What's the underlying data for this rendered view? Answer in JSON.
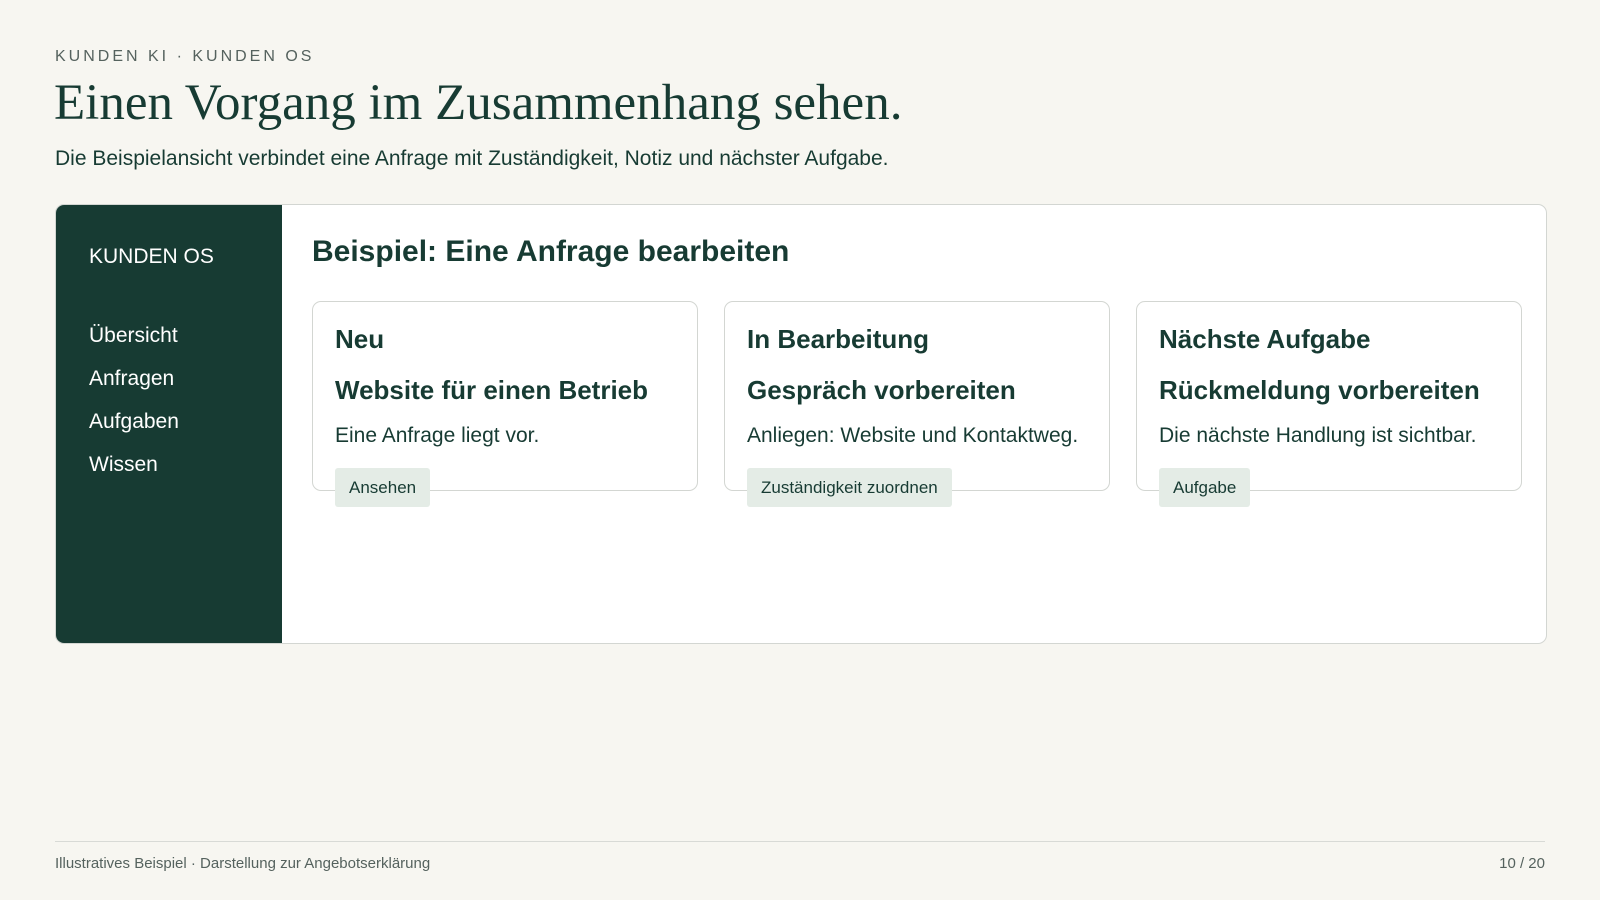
{
  "header": {
    "eyebrow": "KUNDEN KI · KUNDEN OS",
    "title": "Einen Vorgang im Zusammenhang sehen.",
    "subtitle": "Die Beispielansicht verbindet eine Anfrage mit Zuständigkeit, Notiz und nächster Aufgabe."
  },
  "app": {
    "brand": "KUNDEN OS",
    "nav": [
      {
        "label": "Übersicht"
      },
      {
        "label": "Anfragen"
      },
      {
        "label": "Aufgaben"
      },
      {
        "label": "Wissen"
      }
    ],
    "heading": "Beispiel: Eine Anfrage bearbeiten",
    "cards": [
      {
        "status": "Neu",
        "title": "Website für einen Betrieb",
        "description": "Eine Anfrage liegt vor.",
        "button": "Ansehen"
      },
      {
        "status": "In Bearbeitung",
        "title": "Gespräch vorbereiten",
        "description": "Anliegen: Website und Kontaktweg.",
        "button": "Zuständigkeit zuordnen"
      },
      {
        "status": "Nächste Aufgabe",
        "title": "Rückmeldung vorbereiten",
        "description": "Die nächste Handlung ist sichtbar.",
        "button": "Aufgabe"
      }
    ]
  },
  "footer": {
    "note": "Illustratives Beispiel · Darstellung zur Angebotserklärung",
    "page": "10 / 20"
  },
  "colors": {
    "background": "#f7f6f1",
    "primary": "#173b33",
    "button_bg": "#e4ece6",
    "muted": "#55625e"
  }
}
